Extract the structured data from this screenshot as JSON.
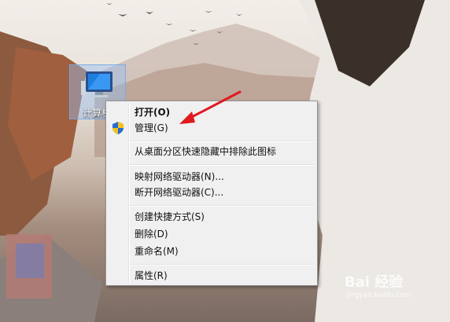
{
  "desktop": {
    "icon_label": "计算机"
  },
  "context_menu": {
    "open": "打开(O)",
    "manage": "管理(G)",
    "remove_from_partition": "从桌面分区快速隐藏中排除此图标",
    "map_drive": "映射网络驱动器(N)...",
    "disconnect_drive": "断开网络驱动器(C)...",
    "create_shortcut": "创建快捷方式(S)",
    "delete": "删除(D)",
    "rename": "重命名(M)",
    "properties": "属性(R)"
  },
  "watermark": {
    "brand": "Bai 经验",
    "url": "jingyan.baidu.com"
  },
  "colors": {
    "arrow": "#e0191e",
    "selection_border": "#7aaae6"
  }
}
